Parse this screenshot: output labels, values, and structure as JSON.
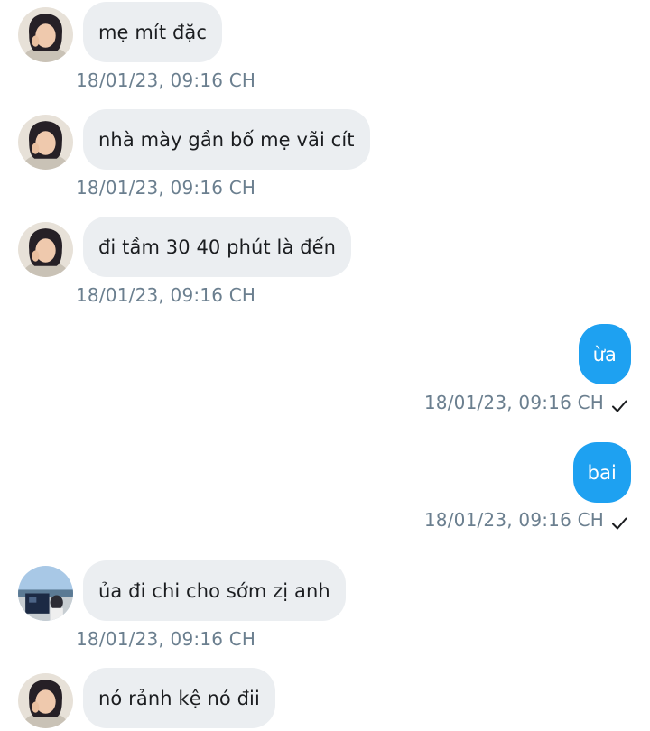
{
  "messages": [
    {
      "direction": "in",
      "avatar": "avatar-girl-icon",
      "text": "mẹ mít đặc",
      "time": "18/01/23,  09:16 CH"
    },
    {
      "direction": "in",
      "avatar": "avatar-girl-icon",
      "text": "nhà mày gần bố mẹ vãi cít",
      "time": "18/01/23,  09:16 CH"
    },
    {
      "direction": "in",
      "avatar": "avatar-girl-icon",
      "text": "đi tầm 30 40 phút là đến",
      "time": "18/01/23,  09:16 CH"
    },
    {
      "direction": "out",
      "text": "ừa",
      "time": "18/01/23,  09:16 CH",
      "status_icon": "checkmark-icon"
    },
    {
      "direction": "out",
      "text": "bai",
      "time": "18/01/23,  09:16 CH",
      "status_icon": "checkmark-icon"
    },
    {
      "direction": "in",
      "avatar": "avatar-landscape-icon",
      "text": "ủa đi chi cho sớm zị anh",
      "time": "18/01/23,  09:16 CH"
    },
    {
      "direction": "in",
      "avatar": "avatar-girl-icon",
      "text": "nó rảnh kệ nó đii"
    }
  ],
  "colors": {
    "incoming_bubble": "#ebeef1",
    "outgoing_bubble": "#1ea1f1",
    "timestamp": "#6b7f8f"
  }
}
